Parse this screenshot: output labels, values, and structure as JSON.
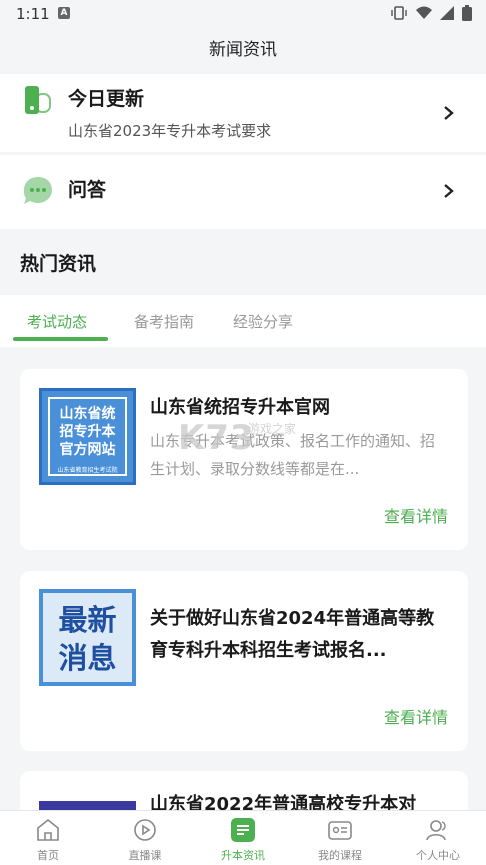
{
  "status_bar": {
    "time": "1:11",
    "notification_letter": "A"
  },
  "header": {
    "title": "新闻资讯"
  },
  "entries": [
    {
      "title": "今日更新",
      "subtitle": "山东省2023年专升本考试要求",
      "icon": "phone-icon"
    },
    {
      "title": "问答",
      "subtitle": "",
      "icon": "chat-bubble-icon"
    }
  ],
  "section": {
    "title": "热门资讯"
  },
  "tabs": [
    {
      "label": "考试动态",
      "active": true
    },
    {
      "label": "备考指南",
      "active": false
    },
    {
      "label": "经验分享",
      "active": false
    }
  ],
  "news": [
    {
      "title": "山东省统招专升本官网",
      "description": "山东专升本考试政策、报名工作的通知、招生计划、录取分数线等都是在...",
      "link": "查看详情",
      "thumb_lines": [
        "山东省统",
        "招专升本",
        "官方网站"
      ],
      "thumb_small": "山东省教育招生考试院"
    },
    {
      "title": "关于做好山东省2024年普通高等教育专科升本科招生考试报名...",
      "description": "",
      "link": "查看详情",
      "thumb_lines": [
        "最新",
        "消息"
      ]
    },
    {
      "title": "山东省2022年普通高校专升本对"
    }
  ],
  "watermark": {
    "main": "K73",
    "sub": "游戏之家"
  },
  "bottom_nav": [
    {
      "label": "首页",
      "icon": "home-icon",
      "active": false
    },
    {
      "label": "直播课",
      "icon": "play-icon",
      "active": false
    },
    {
      "label": "升本资讯",
      "icon": "news-icon",
      "active": true
    },
    {
      "label": "我的课程",
      "icon": "course-icon",
      "active": false
    },
    {
      "label": "个人中心",
      "icon": "user-icon",
      "active": false
    }
  ],
  "colors": {
    "accent": "#4caf50",
    "background": "#f4f5f7",
    "thumb_blue": "#4a90d9"
  }
}
